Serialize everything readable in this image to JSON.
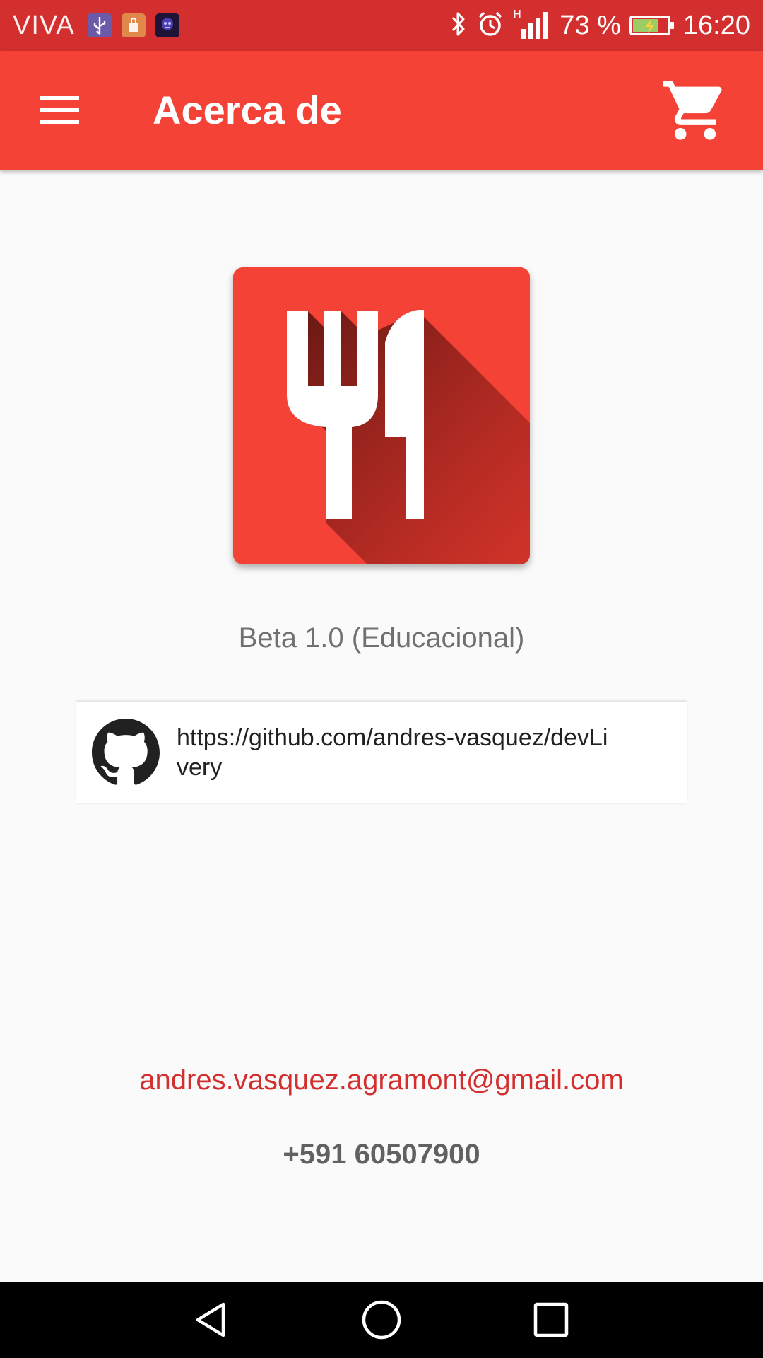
{
  "status_bar": {
    "carrier": "VIVA",
    "battery_percent": "73 %",
    "battery_level": 0.73,
    "network": "H",
    "time": "16:20",
    "notification_icons": [
      "usb-icon",
      "shopping-bag-icon",
      "app-avatar-icon"
    ],
    "system_icons": [
      "bluetooth-icon",
      "alarm-icon",
      "signal-icon",
      "battery-charging-icon"
    ]
  },
  "app_bar": {
    "title": "Acerca de",
    "menu_icon": "hamburger-menu-icon",
    "cart_icon": "shopping-cart-icon"
  },
  "about": {
    "logo_icon": "fork-knife-icon",
    "version": "Beta 1.0 (Educacional)",
    "repo_icon": "github-icon",
    "repo_url": "https://github.com/andres-vasquez/devLivery",
    "email": "andres.vasquez.agramont@gmail.com",
    "phone": "+591 60507900"
  },
  "nav_bar": {
    "buttons": [
      "back-icon",
      "home-icon",
      "recent-apps-icon"
    ]
  },
  "colors": {
    "status_bar": "#d32f2f",
    "app_bar": "#f44336",
    "background": "#fafafa",
    "email": "#d32f2f",
    "version_text": "#707070",
    "phone_text": "#616161"
  }
}
